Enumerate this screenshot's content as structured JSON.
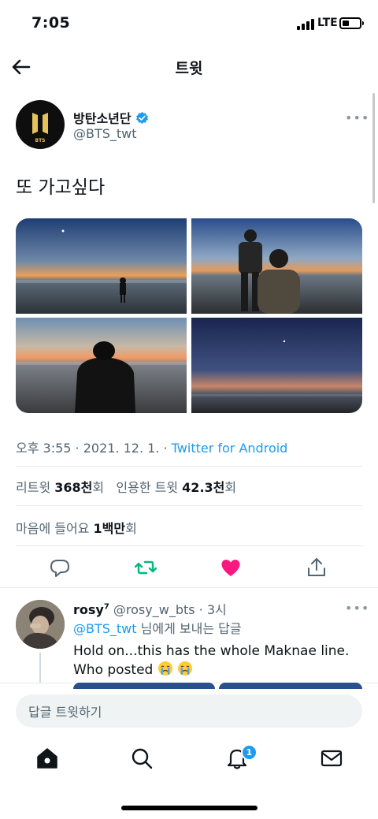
{
  "status_bar": {
    "time": "7:05",
    "network": "LTE",
    "battery_fraction": 0.3
  },
  "header": {
    "title": "트윗"
  },
  "tweet": {
    "author_name": "방탄소년단",
    "author_handle": "@BTS_twt",
    "avatar_logo_text": "BTS",
    "verified": true,
    "text": "또 가고싶다",
    "timestamp": "오후 3:55 · 2021. 12. 1. ·",
    "source": "Twitter for Android",
    "media_count": 4
  },
  "stats": {
    "retweet_label": "리트윗",
    "retweet_count": "368천",
    "retweet_unit": "회",
    "quote_label": "인용한 트윗",
    "quote_count": "42.3천",
    "quote_unit": "회",
    "like_label": "마음에 들어요",
    "like_count": "1백만",
    "like_unit": "회"
  },
  "actions": {
    "reply_icon": "reply-icon",
    "retweet_icon": "retweet-icon",
    "like_icon": "heart-icon",
    "share_icon": "share-icon",
    "retweet_color": "#00ba7c",
    "like_color": "#f91880"
  },
  "reply": {
    "name": "rosy",
    "name_sup": "7",
    "handle": "@rosy_w_bts",
    "time": "· 3시",
    "replying_mention": "@BTS_twt",
    "replying_suffix": "님에게 보내는 답글",
    "text": "Hold on...this has the whole Maknae line. Who posted"
  },
  "compose": {
    "placeholder": "답글 트윗하기"
  },
  "bottom_nav": {
    "items": [
      "home-icon",
      "search-icon",
      "bell-icon",
      "mail-icon"
    ],
    "notification_count": "1"
  },
  "colors": {
    "accent": "#1d9bf0",
    "text": "#0f1419",
    "muted": "#536471"
  }
}
